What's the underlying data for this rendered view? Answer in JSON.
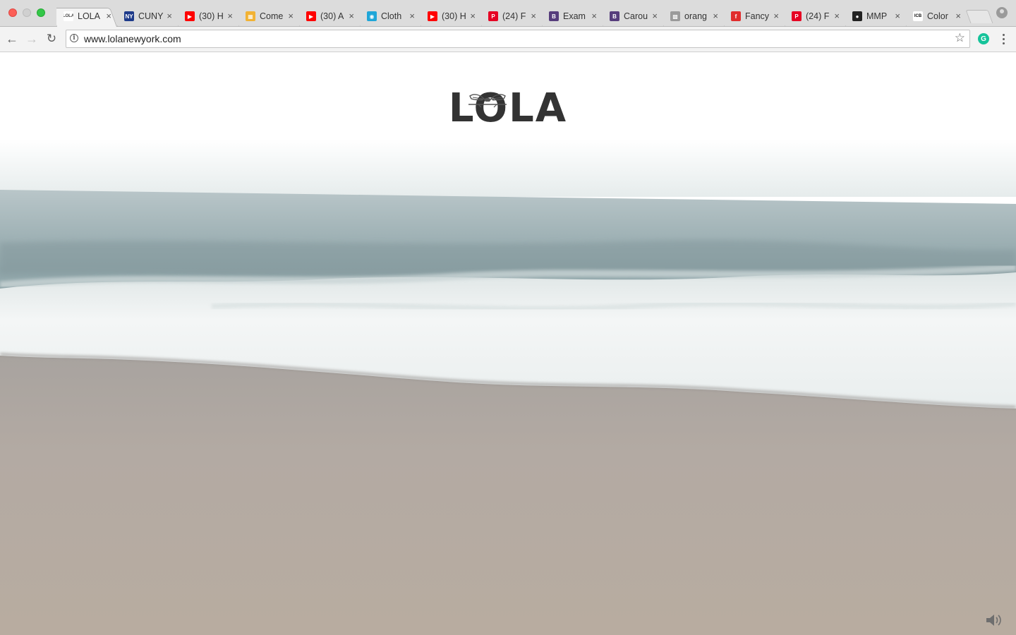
{
  "window": {
    "tabs": [
      {
        "title": "LOLA",
        "favicon_text": "LOLA",
        "favicon_color": "#ffffff",
        "favicon_ink": "#444444",
        "active": true
      },
      {
        "title": "CUNY",
        "favicon_text": "NY",
        "favicon_color": "#1d3a8a",
        "favicon_ink": "#ffffff",
        "active": false
      },
      {
        "title": "(30) H",
        "favicon_text": "▶",
        "favicon_color": "#ff0000",
        "favicon_ink": "#ffffff",
        "active": false
      },
      {
        "title": "Come",
        "favicon_text": "▦",
        "favicon_color": "#f2b233",
        "favicon_ink": "#ffffff",
        "active": false
      },
      {
        "title": "(30) A",
        "favicon_text": "▶",
        "favicon_color": "#ff0000",
        "favicon_ink": "#ffffff",
        "active": false
      },
      {
        "title": "Cloth",
        "favicon_text": "◉",
        "favicon_color": "#1fa6d8",
        "favicon_ink": "#ffffff",
        "active": false
      },
      {
        "title": "(30) H",
        "favicon_text": "▶",
        "favicon_color": "#ff0000",
        "favicon_ink": "#ffffff",
        "active": false
      },
      {
        "title": "(24) F",
        "favicon_text": "P",
        "favicon_color": "#e60023",
        "favicon_ink": "#ffffff",
        "active": false
      },
      {
        "title": "Exam",
        "favicon_text": "B",
        "favicon_color": "#563d7c",
        "favicon_ink": "#ffffff",
        "active": false
      },
      {
        "title": "Carou",
        "favicon_text": "B",
        "favicon_color": "#563d7c",
        "favicon_ink": "#ffffff",
        "active": false
      },
      {
        "title": "orang",
        "favicon_text": "▩",
        "favicon_color": "#9a9a9a",
        "favicon_ink": "#ffffff",
        "active": false
      },
      {
        "title": "Fancy",
        "favicon_text": "f",
        "favicon_color": "#e12c2c",
        "favicon_ink": "#ffffff",
        "active": false
      },
      {
        "title": "(24) F",
        "favicon_text": "P",
        "favicon_color": "#e60023",
        "favicon_ink": "#ffffff",
        "active": false
      },
      {
        "title": "MMP",
        "favicon_text": "●",
        "favicon_color": "#222222",
        "favicon_ink": "#ffffff",
        "active": false
      },
      {
        "title": "Color",
        "favicon_text": "ICB",
        "favicon_color": "#ffffff",
        "favicon_ink": "#111111",
        "active": false
      }
    ],
    "tab_close_glyph": "×"
  },
  "toolbar": {
    "back_glyph": "←",
    "forward_glyph": "→",
    "reload_glyph": "↻",
    "url": "www.lolanewyork.com",
    "info_glyph": "i",
    "star_glyph": "☆",
    "grammarly_glyph": "G"
  },
  "page": {
    "logo_text": "LOLA",
    "colors": {
      "sky_top": "#ffffff",
      "sky_horizon": "#e6ecec",
      "sea_far": "#b9c6c9",
      "sea_near": "#8ea4a8",
      "foam": "#f4f6f6",
      "wet_sand": "#a8a39f",
      "sand": "#b8aca0"
    }
  }
}
